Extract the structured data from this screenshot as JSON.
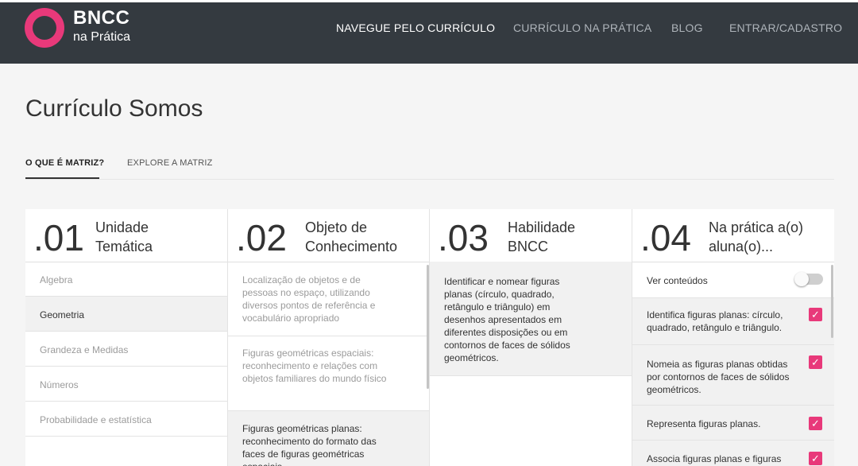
{
  "header": {
    "logo_main": "BNCC",
    "logo_sub": "na Prática",
    "nav": [
      "NAVEGUE PELO CURRÍCULO",
      "CURRÍCULO NA PRÁTICA",
      "BLOG",
      "ENTRAR/CADASTRO"
    ]
  },
  "page": {
    "title": "Currículo Somos",
    "tabs": [
      "O QUE É MATRIZ?",
      "EXPLORE A MATRIZ"
    ]
  },
  "columns": [
    {
      "num": ".01",
      "title": "Unidade Temática"
    },
    {
      "num": ".02",
      "title": "Objeto de Conhecimento"
    },
    {
      "num": ".03",
      "title": "Habilidade BNCC"
    },
    {
      "num": ".04",
      "title": "Na prática a(o) aluna(o)..."
    }
  ],
  "col1": [
    "Algebra",
    "Geometria",
    "Grandeza e Medidas",
    "Números",
    "Probabilidade e estatística"
  ],
  "col2": [
    "Localização de objetos e de pessoas no espaço, utilizando diversos pontos de referência e vocabulário apropriado",
    "Figuras geométricas espaciais: reconhecimento e relações com objetos familiares do mundo físico",
    "Figuras geométricas planas: reconhecimento do formato das faces de figuras geométricas espaciais"
  ],
  "col3": [
    "Identificar e nomear figuras planas (círculo, quadrado, retângulo e triângulo) em desenhos apresentados em diferentes disposições ou em contornos de faces de sólidos geométricos."
  ],
  "col4": {
    "toggle_label": "Ver conteúdos",
    "items": [
      "Identifica figuras planas: círculo, quadrado, retângulo e triângulo.",
      "Nomeia as figuras planas obtidas por contornos de faces de sólidos geométricos.",
      "Representa figuras planas.",
      "Associa figuras planas e figuras"
    ]
  },
  "colors": {
    "accent": "#e8397a",
    "header_bg": "#343a40"
  }
}
